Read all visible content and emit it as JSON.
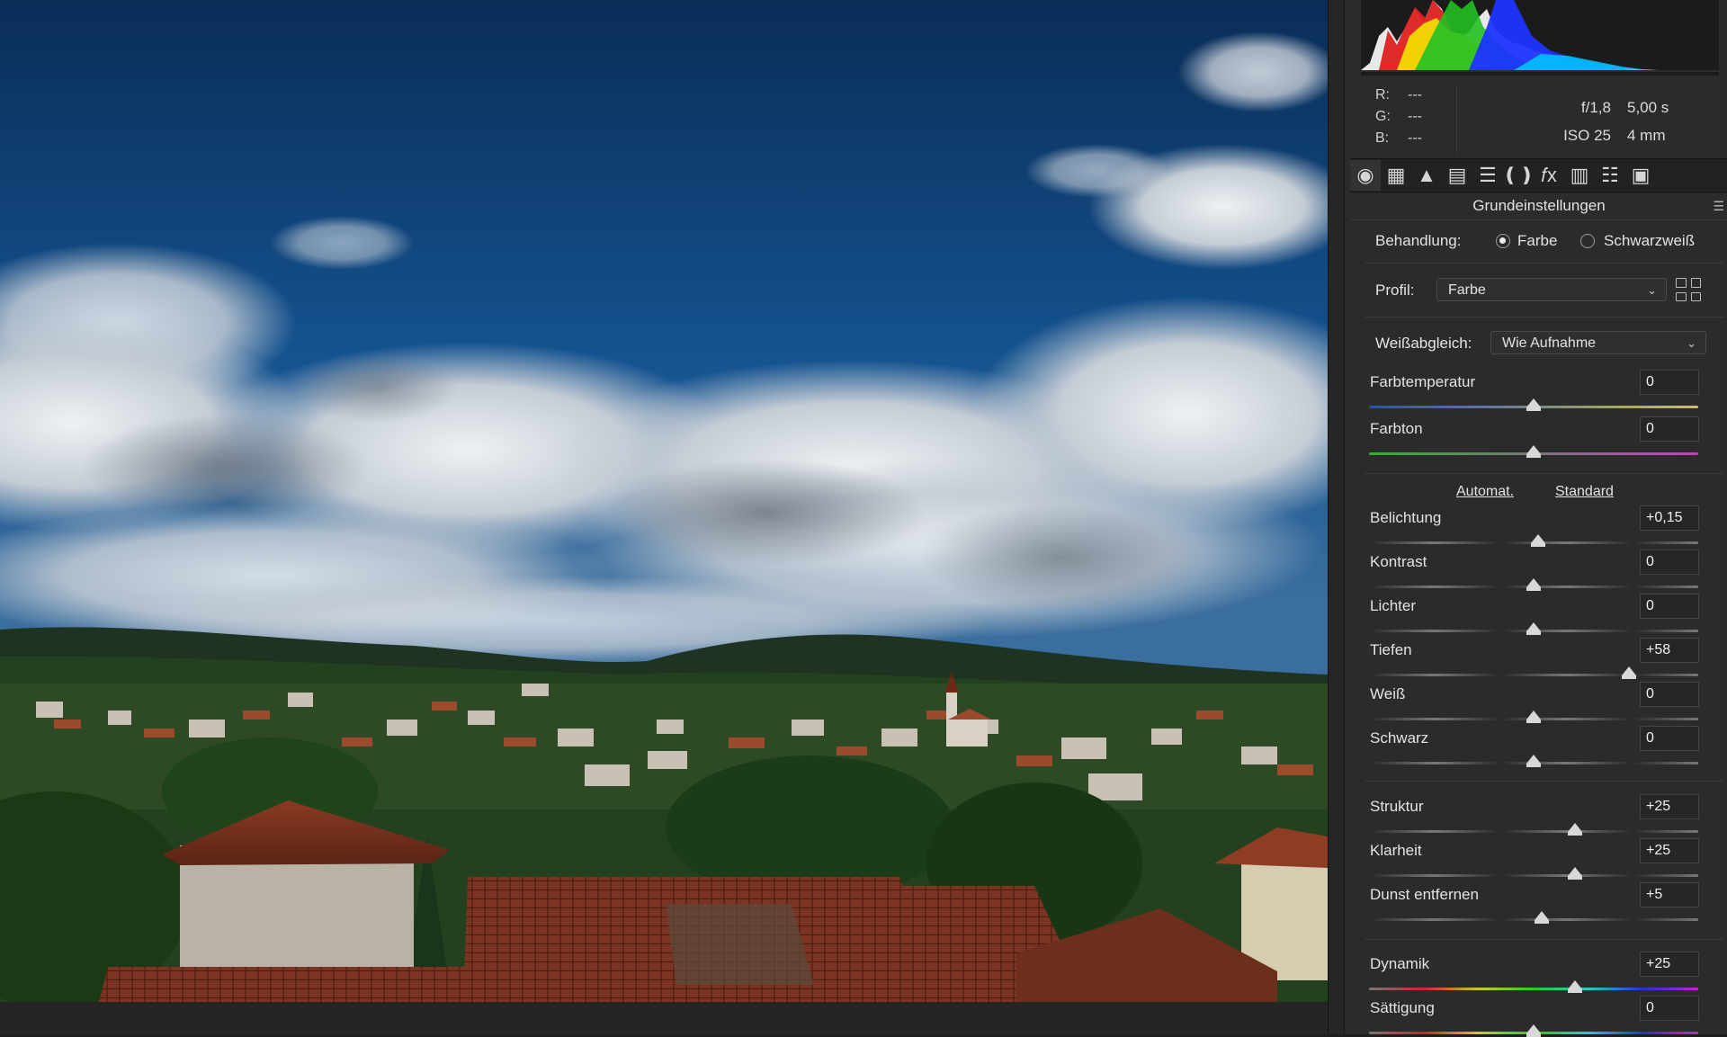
{
  "image": {
    "description_icons": [
      "sky",
      "clouds",
      "town",
      "roofs"
    ]
  },
  "histogram": {
    "colors": [
      "#e02020",
      "#f5e300",
      "#22c022",
      "#1e34ff",
      "#00c8ff",
      "#ffffff"
    ]
  },
  "readout": {
    "r_label": "R:",
    "r_value": "---",
    "g_label": "G:",
    "g_value": "---",
    "b_label": "B:",
    "b_value": "---"
  },
  "exif": {
    "aperture": "f/1,8",
    "shutter": "5,00 s",
    "iso": "ISO 25",
    "focal": "4 mm"
  },
  "toolbar": {
    "icons": [
      "aperture-icon",
      "grid-curve-icon",
      "mountain-detail-icon",
      "hsl-icon",
      "split-tone-icon",
      "lens-icon",
      "fx-icon",
      "camera-calibration-icon",
      "presets-icon",
      "snapshots-icon"
    ],
    "glyphs": [
      "◉",
      "▦",
      "▲",
      "▤",
      "☰",
      "❪❫",
      "𝑓x",
      "▥",
      "☷",
      "▣"
    ]
  },
  "panel": {
    "title": "Grundeinstellungen",
    "menu_glyph": "☰",
    "treatment": {
      "label": "Behandlung:",
      "option_color": "Farbe",
      "option_bw": "Schwarzweiß",
      "selected": "Farbe"
    },
    "profile": {
      "label": "Profil:",
      "value": "Farbe"
    },
    "white_balance": {
      "label": "Weißabgleich:",
      "value": "Wie Aufnahme"
    },
    "auto_label": "Automat.",
    "default_label": "Standard",
    "chevron": "⌄"
  },
  "sliders": [
    {
      "key": "temp",
      "name": "Farbtemperatur",
      "value": "0",
      "level": 0.5
    },
    {
      "key": "tint",
      "name": "Farbton",
      "value": "0",
      "level": 0.5
    },
    {
      "key": "exposure",
      "name": "Belichtung",
      "value": "+0,15",
      "level": 0.515
    },
    {
      "key": "contrast",
      "name": "Kontrast",
      "value": "0",
      "level": 0.5
    },
    {
      "key": "highlights",
      "name": "Lichter",
      "value": "0",
      "level": 0.5
    },
    {
      "key": "shadows",
      "name": "Tiefen",
      "value": "+58",
      "level": 0.79
    },
    {
      "key": "whites",
      "name": "Weiß",
      "value": "0",
      "level": 0.5
    },
    {
      "key": "blacks",
      "name": "Schwarz",
      "value": "0",
      "level": 0.5
    },
    {
      "key": "texture",
      "name": "Struktur",
      "value": "+25",
      "level": 0.625
    },
    {
      "key": "clarity",
      "name": "Klarheit",
      "value": "+25",
      "level": 0.625
    },
    {
      "key": "dehaze",
      "name": "Dunst entfernen",
      "value": "+5",
      "level": 0.525
    },
    {
      "key": "vibrance",
      "name": "Dynamik",
      "value": "+25",
      "level": 0.625
    },
    {
      "key": "saturation",
      "name": "Sättigung",
      "value": "0",
      "level": 0.5
    }
  ]
}
